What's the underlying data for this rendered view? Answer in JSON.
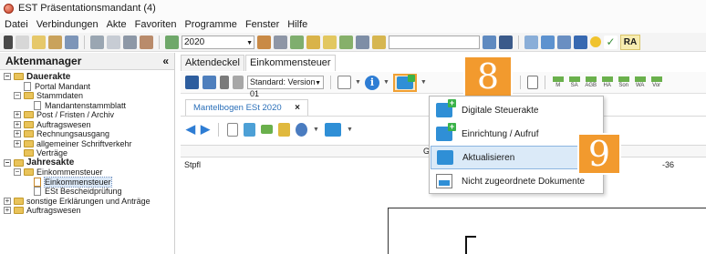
{
  "window": {
    "title": "EST Präsentationsmandant (4)"
  },
  "menu": {
    "items": [
      "Datei",
      "Verbindungen",
      "Akte",
      "Favoriten",
      "Programme",
      "Fenster",
      "Hilfe"
    ]
  },
  "toolbar": {
    "year": "2020",
    "ra_label": "RA"
  },
  "left_panel": {
    "title": "Aktenmanager",
    "collapse_glyph": "«",
    "tree": [
      {
        "label": "Dauerakte",
        "bold": true,
        "expander": "−",
        "type": "folder"
      },
      {
        "label": "Portal Mandant",
        "type": "doc"
      },
      {
        "label": "Stammdaten",
        "expander": "−",
        "type": "folder"
      },
      {
        "label": "Mandantenstammblatt",
        "type": "doc"
      },
      {
        "label": "Post / Fristen / Archiv",
        "expander": "+",
        "type": "folder"
      },
      {
        "label": "Auftragswesen",
        "expander": "+",
        "type": "folder"
      },
      {
        "label": "Rechnungsausgang",
        "expander": "+",
        "type": "folder"
      },
      {
        "label": "allgemeiner Schriftverkehr",
        "expander": "+",
        "type": "folder"
      },
      {
        "label": "Verträge",
        "type": "folder"
      },
      {
        "label": "Jahresakte",
        "bold": true,
        "expander": "−",
        "type": "folder"
      },
      {
        "label": "Einkommensteuer",
        "expander": "−",
        "type": "folder"
      },
      {
        "label": "Einkommensteuer",
        "type": "doc",
        "selected": true
      },
      {
        "label": "ESt Bescheidprüfung",
        "type": "doc"
      },
      {
        "label": "sonstige Erklärungen und Anträge",
        "expander": "+",
        "type": "folder"
      },
      {
        "label": "Auftragswesen",
        "expander": "+",
        "type": "folder"
      }
    ]
  },
  "tabs": [
    {
      "label": "Aktendeckel"
    },
    {
      "label": "Einkommensteuer",
      "active": true
    }
  ],
  "doc_toolbar": {
    "version": "Standard: Version 01",
    "mini_buttons": [
      "M",
      "SA",
      "AGB",
      "HA",
      "Son",
      "WA",
      "Vor"
    ],
    "badge_8": "8",
    "badge_9": "9"
  },
  "sub_tab": {
    "label": "Mantelbogen ESt 2020",
    "close": "×"
  },
  "grid": {
    "header_letter": "G",
    "row_label": "Stpfl",
    "row_value": "-36"
  },
  "dropdown": {
    "items": [
      {
        "label": "Digitale Steuerakte",
        "icon": "dsa-plus-icon"
      },
      {
        "label": "Einrichtung / Aufruf",
        "icon": "dsa-setup-icon"
      },
      {
        "label": "Aktualisieren",
        "icon": "dsa-refresh-icon",
        "highlight": true
      },
      {
        "label": "Nicht zugeordnete Dokumente",
        "icon": "dsa-doc-icon"
      }
    ]
  }
}
